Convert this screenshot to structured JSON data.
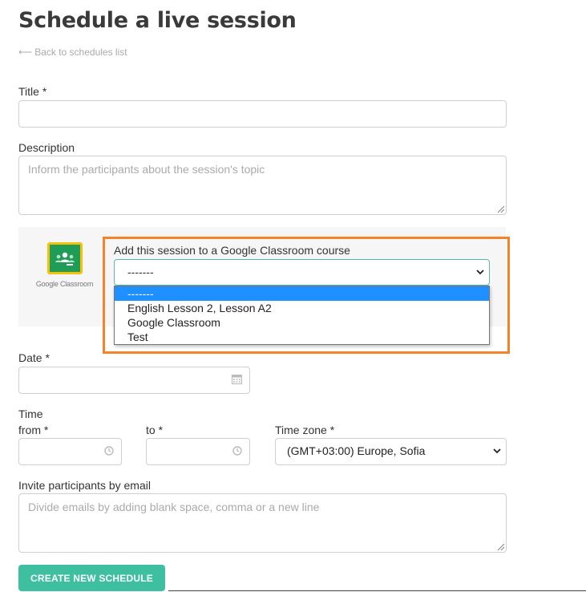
{
  "page": {
    "title": "Schedule a live session",
    "back_link": "Back to schedules list"
  },
  "form": {
    "title_label": "Title *",
    "title_value": "",
    "description_label": "Description",
    "description_placeholder": "Inform the participants about the session's topic",
    "google_classroom": {
      "logo_text": "Google Classroom",
      "label": "Add this session to a Google Classroom course",
      "selected": "-------",
      "options": [
        "-------",
        "English Lesson 2, Lesson A2",
        "Google Classroom",
        "Test"
      ]
    },
    "date_label": "Date *",
    "time_label": "Time",
    "from_label": "from *",
    "to_label": "to *",
    "timezone_label": "Time zone *",
    "timezone_value": "(GMT+03:00) Europe, Sofia",
    "invite_label": "Invite participants by email",
    "invite_placeholder": "Divide emails by adding blank space, comma or a new line",
    "create_button": "CREATE NEW SCHEDULE"
  },
  "colors": {
    "accent": "#3dbfa0",
    "highlight": "#f5832a",
    "dropdown_selected": "#1e90ff"
  },
  "icons": [
    "arrow-left-icon",
    "calendar-icon",
    "clock-icon",
    "chevron-down-icon",
    "google-classroom-logo"
  ]
}
